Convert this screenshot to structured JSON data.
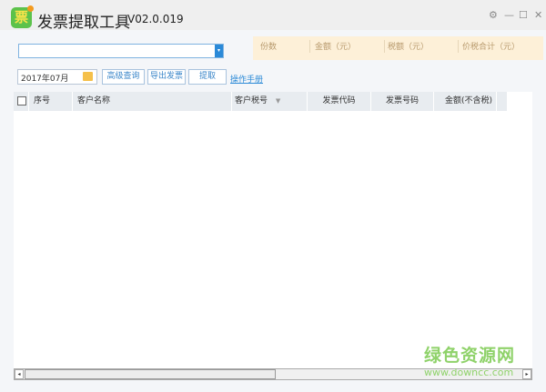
{
  "app": {
    "logo_char": "票",
    "title": "发票提取工具",
    "version": "V02.0.019"
  },
  "window": {
    "settings": "⚙",
    "minimize": "—",
    "maximize": "☐",
    "close": "✕"
  },
  "company_select": {
    "value": "",
    "arrow": "▾"
  },
  "summary": {
    "count_label": "份数",
    "amount_label": "金额（元）",
    "tax_label": "税额（元）",
    "total_label": "价税合计（元）"
  },
  "toolbar": {
    "date": "2017年07月",
    "advanced_query": "高级查询",
    "export": "导出发票",
    "extract": "提取",
    "manual": "操作手册"
  },
  "table": {
    "columns": [
      "序号",
      "客户名称",
      "客户税号",
      "发票代码",
      "发票号码",
      "金额(不含税)"
    ],
    "filter_icon": "▼",
    "rows": []
  },
  "scrollbar": {
    "left": "◂",
    "right": "▸"
  },
  "watermark": {
    "cn": "绿色资源网",
    "url": "www.downcc.com"
  }
}
